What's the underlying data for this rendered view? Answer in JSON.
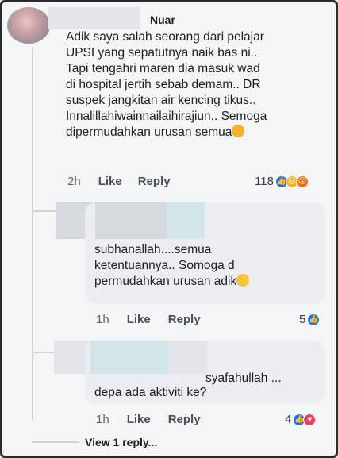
{
  "comments": [
    {
      "author_suffix": "Nuar",
      "text": "Adik saya salah seorang dari pelajar\nUPSI yang sepatutnya naik bas ni..\nTapi tengahri maren dia masuk wad\ndi hospital jertih sebab demam.. DR\nsuspek jangkitan air kencing tikus..\nInnalillahiwainnailaihirajiun.. Semoga\ndipermudahkan urusan semua",
      "time": "2h",
      "like_label": "Like",
      "reply_label": "Reply",
      "reaction_count": "118",
      "reactions": [
        "like-icon",
        "sad-icon",
        "angry-icon"
      ]
    }
  ],
  "replies": [
    {
      "text": "subhanallah....semua\nketentuannya.. Somoga d\npermudahkan urusan adik",
      "time": "1h",
      "like_label": "Like",
      "reply_label": "Reply",
      "reaction_count": "5",
      "reactions": [
        "like-icon"
      ]
    },
    {
      "text_inline": "syafahullah ...",
      "text": "depa ada aktiviti ke?",
      "time": "1h",
      "like_label": "Like",
      "reply_label": "Reply",
      "reaction_count": "4",
      "reactions": [
        "like-icon",
        "love-icon"
      ]
    }
  ],
  "view_replies_label": "View 1 reply..."
}
